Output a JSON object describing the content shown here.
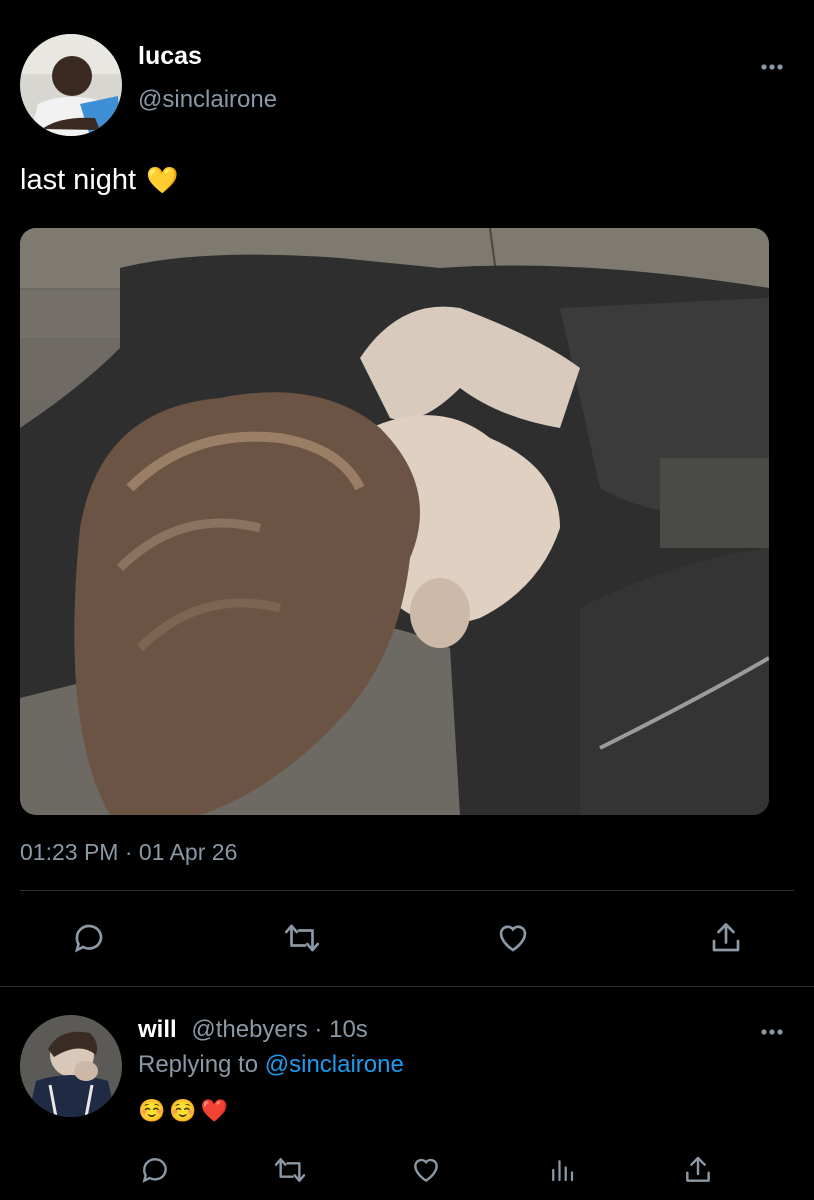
{
  "tweet": {
    "author_name": "lucas",
    "author_handle": "@sinclairone",
    "text": "last night",
    "emoji": "💛",
    "timestamp": "01:23 PM · 01 Apr 26",
    "avatar_icon": "user-avatar-photo",
    "actions": [
      "reply-icon",
      "retweet-icon",
      "like-icon",
      "share-icon"
    ]
  },
  "reply": {
    "author_name": "will",
    "author_handle": "@thebyers",
    "separator": " · ",
    "time": "10s",
    "replying_label": "Replying to",
    "replying_handle": "@sinclairone",
    "emojis": [
      "☺️",
      "☺️",
      "❤️"
    ],
    "actions": [
      "reply-icon",
      "retweet-icon",
      "like-icon",
      "analytics-icon",
      "share-icon"
    ]
  },
  "colors": {
    "background": "#000000",
    "text_primary": "#ffffff",
    "text_secondary": "#8b98a5",
    "link": "#1d9bf0",
    "divider": "#2f3336"
  }
}
